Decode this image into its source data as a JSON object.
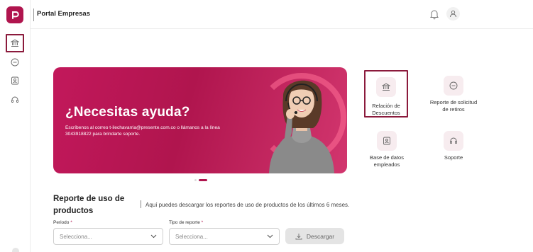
{
  "app": {
    "title": "Portal Empresas"
  },
  "sidebar": {
    "items": [
      {
        "icon": "bank-icon",
        "active": true
      },
      {
        "icon": "minus-circle-icon"
      },
      {
        "icon": "id-card-icon"
      },
      {
        "icon": "headset-icon"
      }
    ]
  },
  "banner": {
    "heading": "¿Necesitas ayuda?",
    "body": "Escríbenos al correo t-ilechavarria@presente.com.co o llámanos a la línea 3043918822 para brindarte soporte."
  },
  "shortcuts": [
    {
      "label": "Relación de Descuentos",
      "icon": "bank-icon",
      "highlighted": true
    },
    {
      "label": "Reporte de solicitud de retiros",
      "icon": "minus-circle-icon"
    },
    {
      "label": "Base de datos empleados",
      "icon": "id-card-icon"
    },
    {
      "label": "Soporte",
      "icon": "headset-icon"
    }
  ],
  "report": {
    "title": "Reporte de uso de productos",
    "description": "Aquí puedes descargar los reportes de uso de productos de los últimos 6 meses.",
    "periodo": {
      "label": "Periodo",
      "required_mark": "*",
      "placeholder": "Selecciona..."
    },
    "tipo": {
      "label": "Tipo de reporte",
      "required_mark": "*",
      "placeholder": "Selecciona..."
    },
    "download_label": "Descargar"
  },
  "colors": {
    "brand": "#b0154e",
    "highlight_border": "#8b1a3c"
  }
}
